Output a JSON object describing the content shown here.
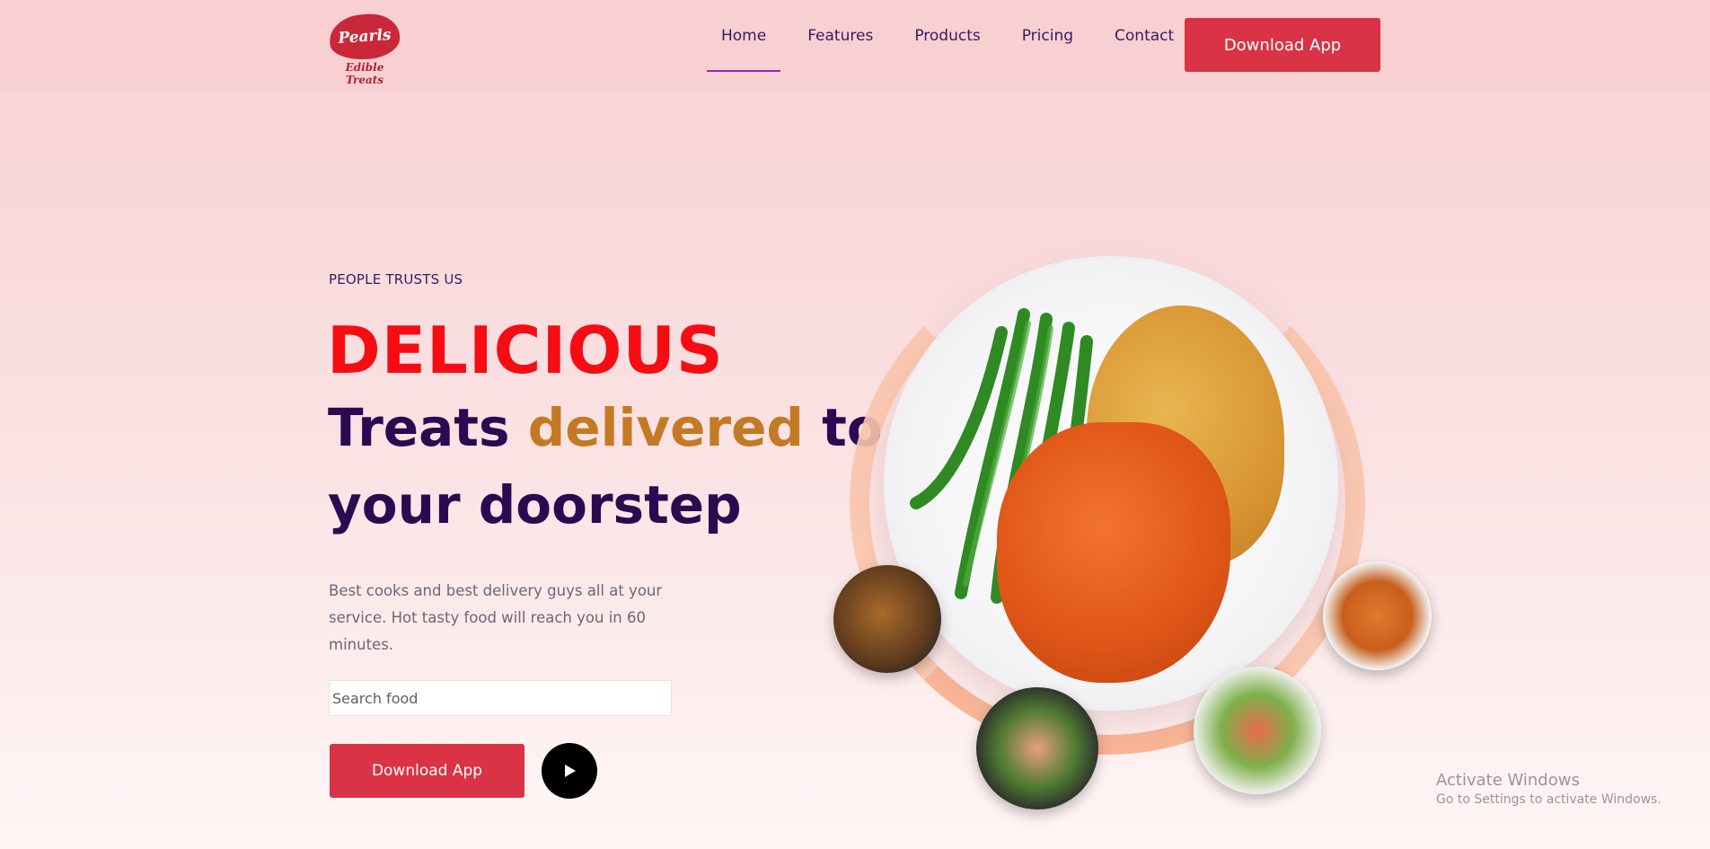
{
  "brand": {
    "logo_text": "Pearls",
    "tagline": "Edible Treats",
    "accent_color": "#d93345",
    "headline_red": "#f60c12",
    "headline_dark": "#2b0a52",
    "headline_gold": "#c47a24"
  },
  "nav": {
    "items": [
      {
        "label": "Home",
        "active": true
      },
      {
        "label": "Features",
        "active": false
      },
      {
        "label": "Products",
        "active": false
      },
      {
        "label": "Pricing",
        "active": false
      },
      {
        "label": "Contact",
        "active": false
      }
    ],
    "cta_label": "Download App"
  },
  "hero": {
    "eyebrow": "PEOPLE TRUSTS US",
    "headline_line1": "DELICIOUS",
    "headline_line2_a": "Treats ",
    "headline_line2_b": "delivered",
    "headline_line2_c": " to",
    "headline_line3": "your doorstep",
    "description": "Best cooks and best delivery guys all at your service. Hot tasty food will reach you in 60 minutes.",
    "search_placeholder": "Search food",
    "cta_label": "Download App",
    "play_icon": "play-icon"
  },
  "watermark": {
    "line1": "Activate Windows",
    "line2": "Go to Settings to activate Windows."
  }
}
